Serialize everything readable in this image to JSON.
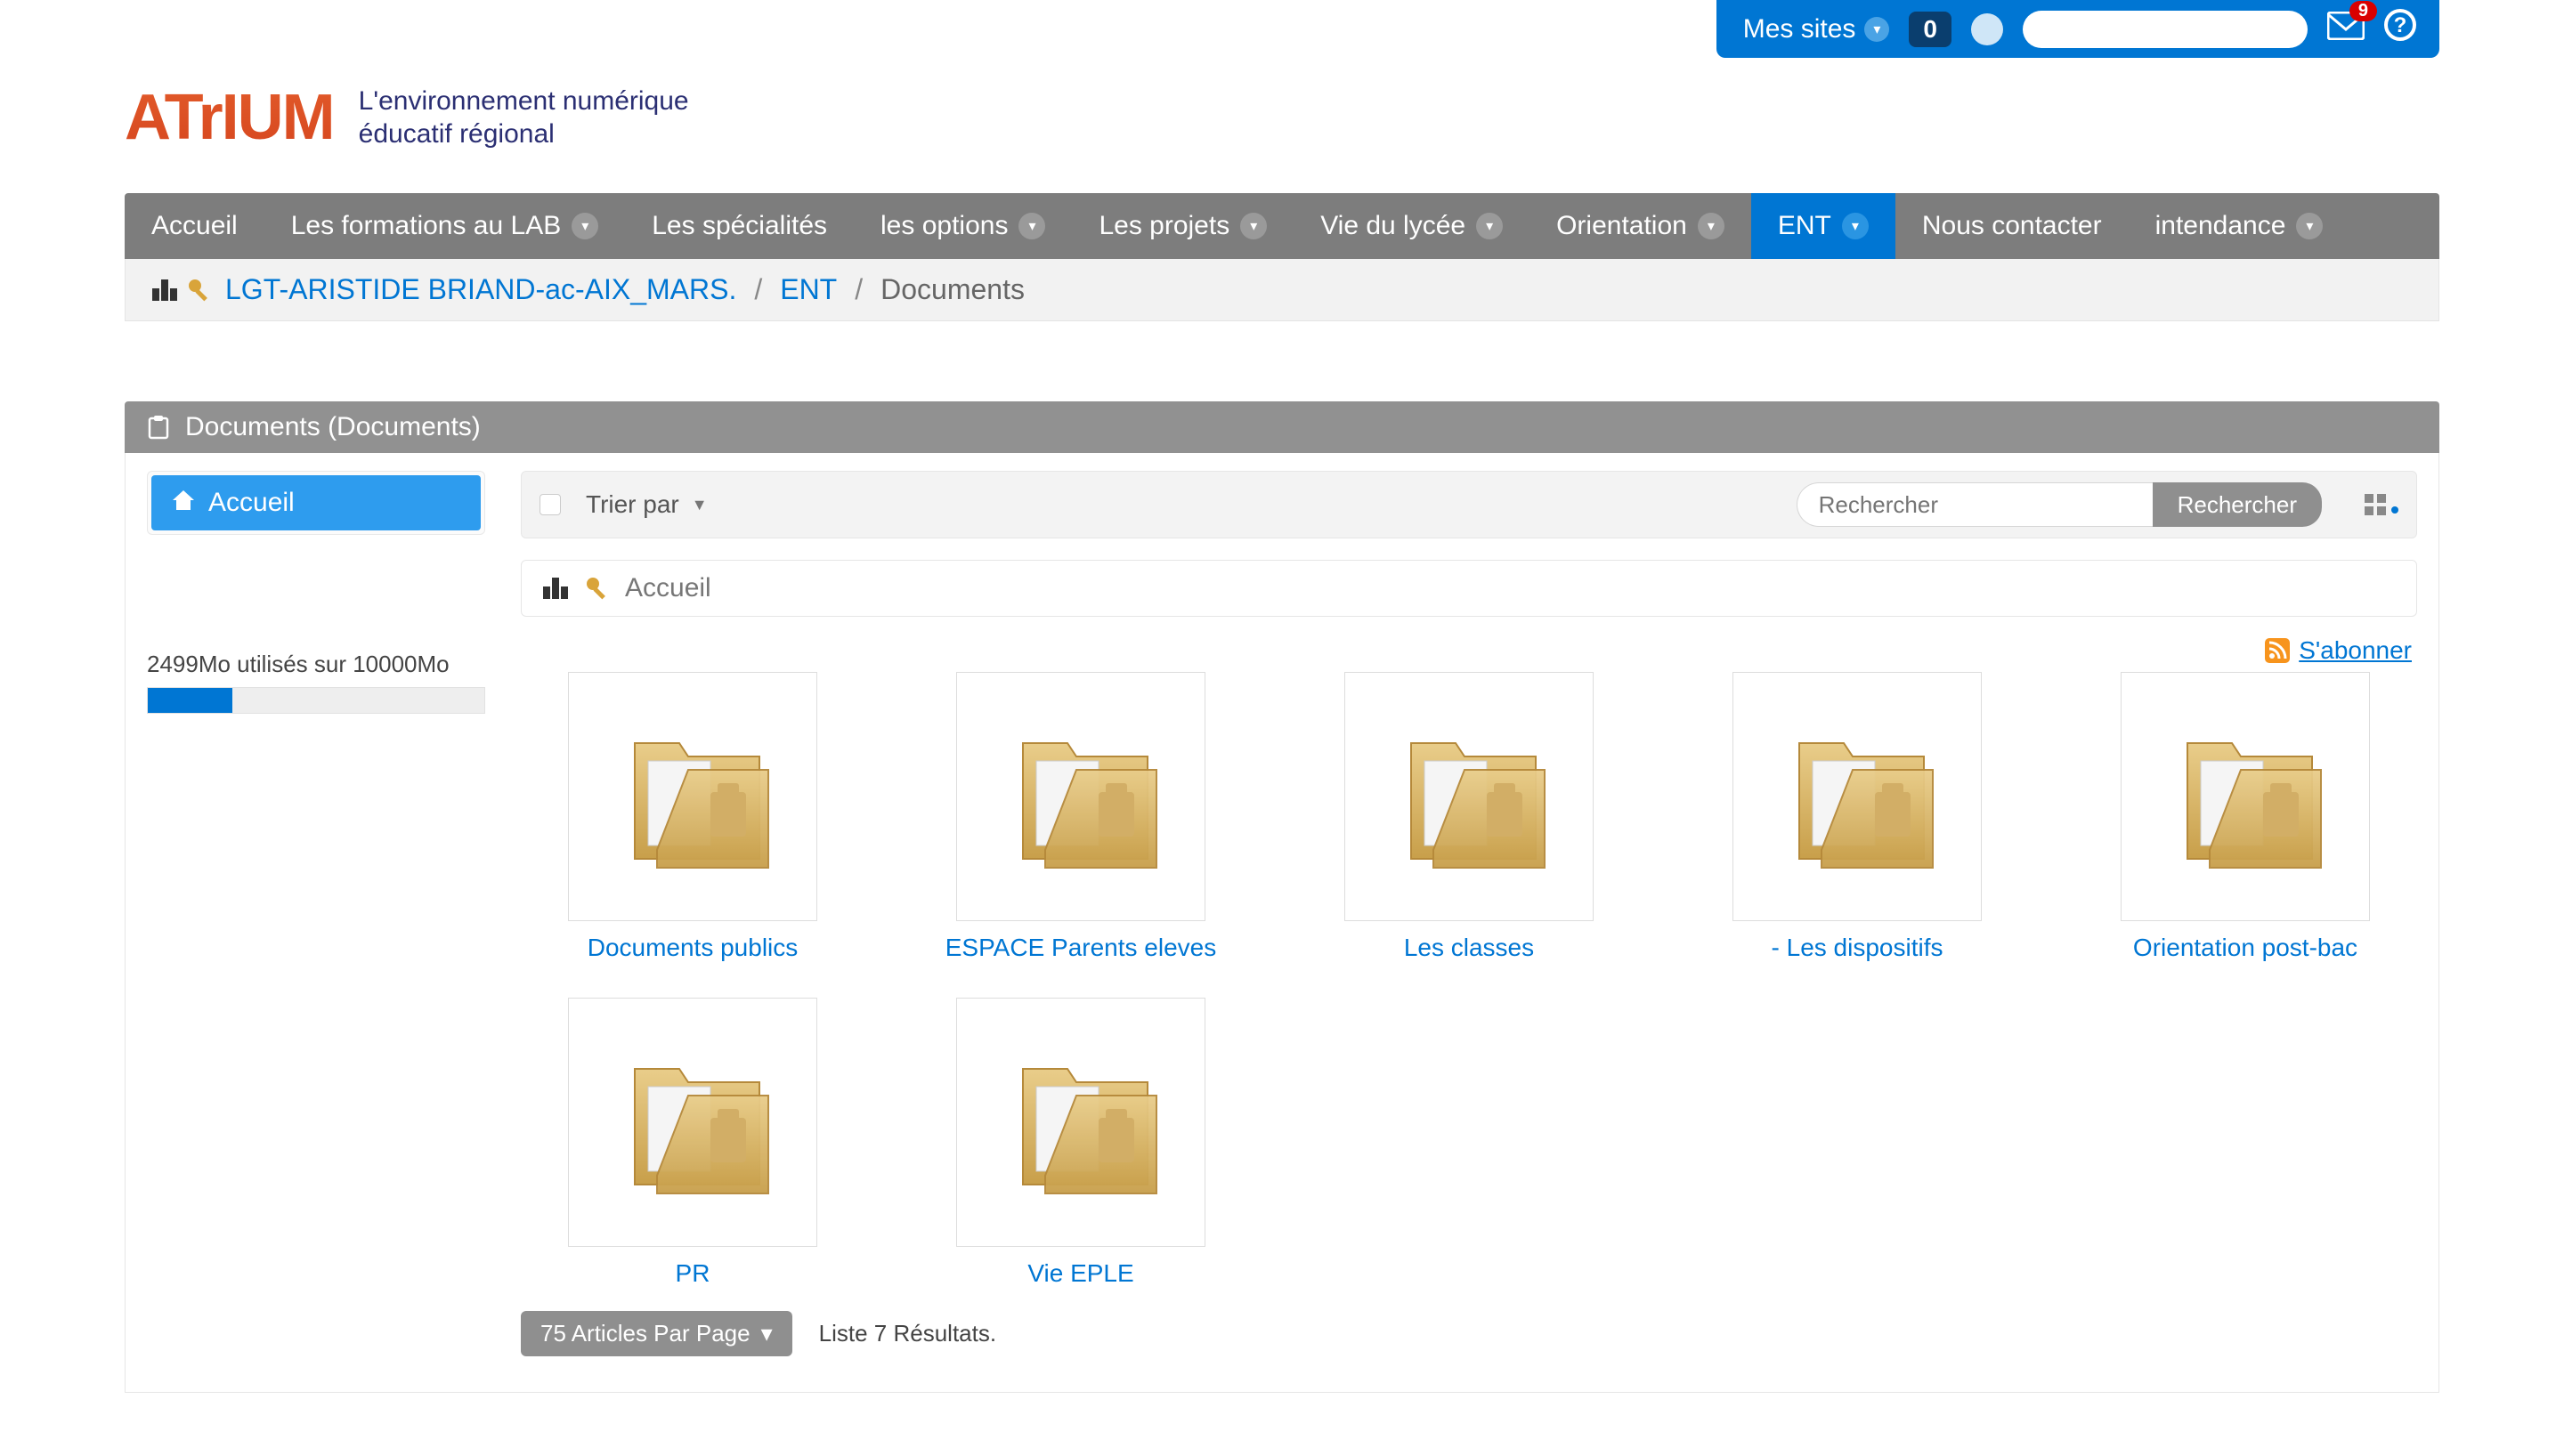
{
  "topbar": {
    "mes_sites": "Mes sites",
    "count": "0",
    "mail_badge": "9",
    "help": "?"
  },
  "brand": {
    "logo": "ATrIUM",
    "tagline_l1": "L'environnement numérique",
    "tagline_l2": "éducatif régional"
  },
  "nav": {
    "accueil": "Accueil",
    "formations": "Les formations au LAB",
    "specialites": "Les spécialités",
    "options": "les options",
    "projets": "Les projets",
    "vie": "Vie du lycée",
    "orientation": "Orientation",
    "ent": "ENT",
    "contacter": "Nous contacter",
    "intendance": "intendance"
  },
  "breadcrumb": {
    "site": "LGT-ARISTIDE BRIAND-ac-AIX_MARS.",
    "ent": "ENT",
    "current": "Documents"
  },
  "panel": {
    "title": "Documents (Documents)"
  },
  "sidebar": {
    "accueil": "Accueil"
  },
  "quota": {
    "text": "2499Mo utilisés sur 10000Mo",
    "percent": 25
  },
  "toolbar": {
    "sort": "Trier par",
    "search_placeholder": "Rechercher",
    "search_btn": "Rechercher"
  },
  "location": {
    "label": "Accueil"
  },
  "subscribe": "S'abonner",
  "folders": {
    "f0": "Documents publics",
    "f1": "ESPACE Parents eleves",
    "f2": "Les classes",
    "f3": "- Les dispositifs",
    "f4": "Orientation post-bac",
    "f5": "PR",
    "f6": "Vie EPLE"
  },
  "pager": {
    "btn": "75 Articles Par Page",
    "results": "Liste 7 Résultats."
  }
}
